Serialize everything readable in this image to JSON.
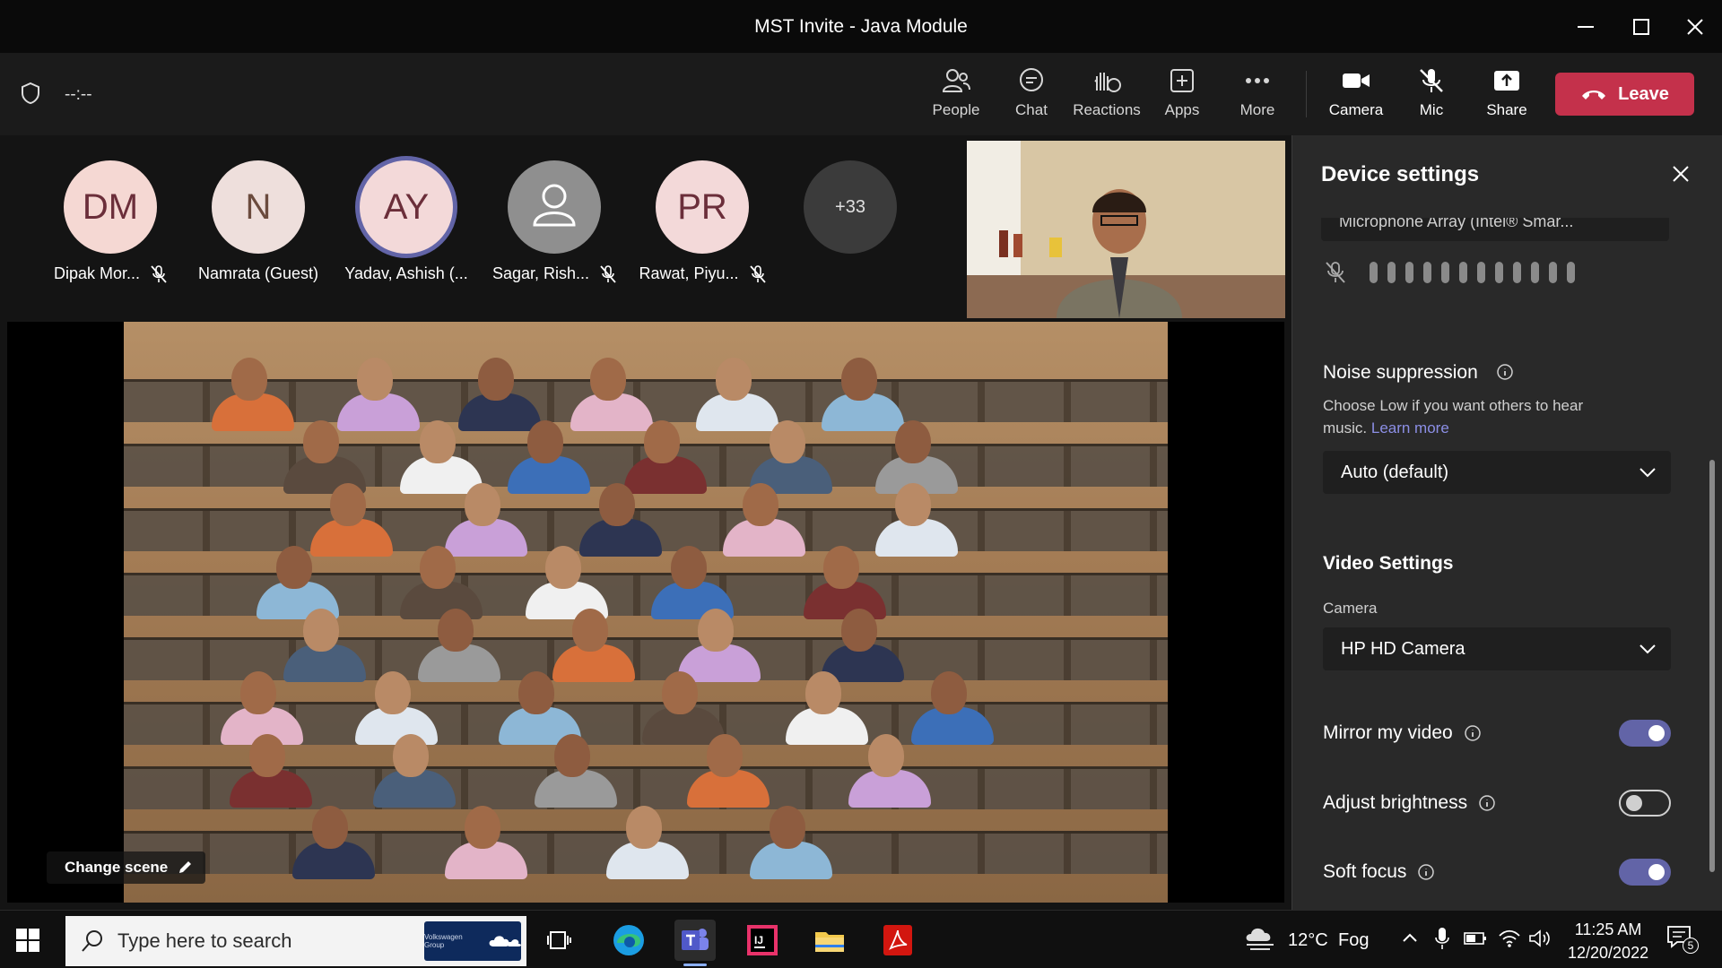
{
  "window": {
    "title": "MST Invite - Java Module"
  },
  "toolbar": {
    "timer": "--:--",
    "buttons": [
      {
        "label": "People",
        "icon": "people-icon"
      },
      {
        "label": "Chat",
        "icon": "chat-icon"
      },
      {
        "label": "Reactions",
        "icon": "reactions-icon"
      },
      {
        "label": "Apps",
        "icon": "apps-icon"
      },
      {
        "label": "More",
        "icon": "more-icon"
      },
      {
        "label": "Camera",
        "icon": "camera-icon"
      },
      {
        "label": "Mic",
        "icon": "mic-off-icon"
      },
      {
        "label": "Share",
        "icon": "share-icon"
      }
    ],
    "leave_label": "Leave"
  },
  "participants": [
    {
      "initials": "DM",
      "name": "Dipak Mor...",
      "muted": true
    },
    {
      "initials": "N",
      "name": "Namrata (Guest)",
      "muted": false
    },
    {
      "initials": "AY",
      "name": "Yadav, Ashish (...",
      "muted": false,
      "speaking": true
    },
    {
      "initials": "",
      "name": "Sagar, Rish...",
      "muted": true
    },
    {
      "initials": "PR",
      "name": "Rawat, Piyu...",
      "muted": true
    }
  ],
  "overflow_count": "+33",
  "stage": {
    "change_scene_label": "Change scene"
  },
  "device_settings": {
    "title": "Device settings",
    "microphone_partial": "Microphone Array (Intel® Smar...",
    "noise_suppression": {
      "heading": "Noise suppression",
      "description": "Choose Low if you want others to hear music.",
      "learn_more": "Learn more",
      "selected": "Auto (default)"
    },
    "video_settings": {
      "heading": "Video Settings",
      "camera_label": "Camera",
      "camera_selected": "HP HD Camera"
    },
    "toggles": [
      {
        "label": "Mirror my video",
        "on": true
      },
      {
        "label": "Adjust brightness",
        "on": false
      },
      {
        "label": "Soft focus",
        "on": true
      }
    ]
  },
  "taskbar": {
    "search_placeholder": "Type here to search",
    "banner_text": "Volkswagen Group",
    "weather_temp": "12°C",
    "weather_text": "Fog",
    "time": "11:25 AM",
    "date": "12/20/2022",
    "notification_count": "5"
  }
}
